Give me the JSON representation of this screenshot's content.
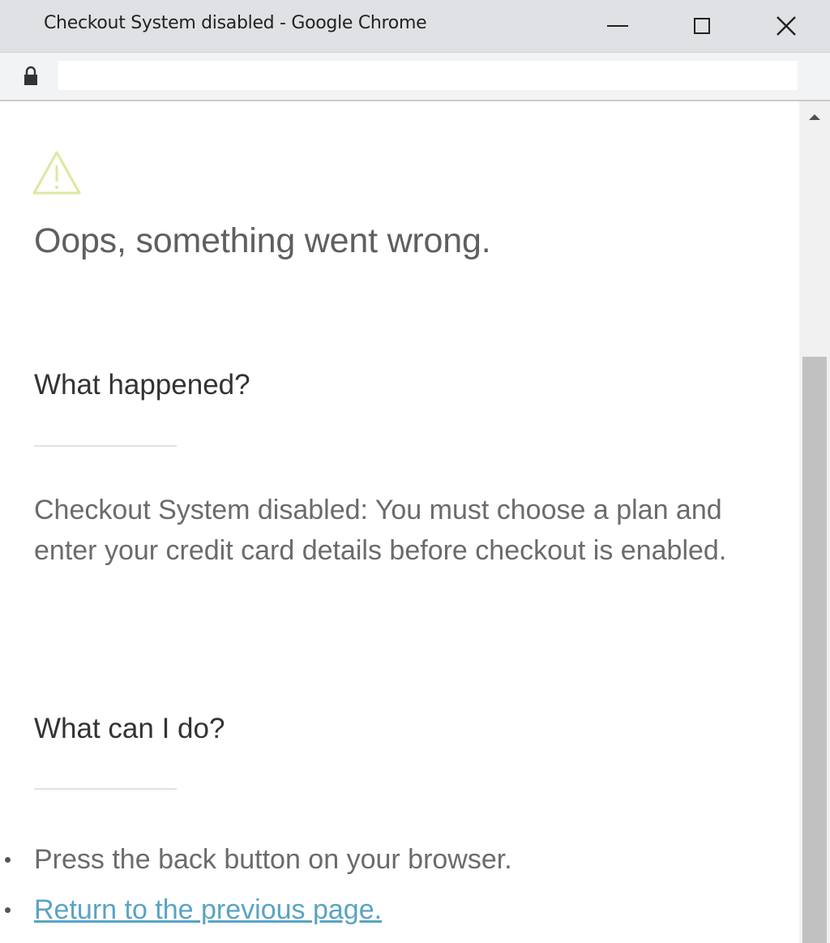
{
  "window": {
    "title": "Checkout System disabled - Google Chrome",
    "controls": {
      "minimize": "minimize",
      "maximize": "maximize",
      "close": "close"
    }
  },
  "address_bar": {
    "url": "",
    "security_icon": "lock-icon"
  },
  "page": {
    "icon": "warning-icon",
    "icon_color": "#d8e28a",
    "heading": "Oops, something went wrong.",
    "what_happened": {
      "title": "What happened?",
      "message": "Checkout System disabled: You must choose a plan and enter your credit card details before checkout is enabled."
    },
    "what_can_i_do": {
      "title": "What can I do?",
      "items": [
        {
          "text": "Press the back button on your browser."
        },
        {
          "text": "Return to the previous page.",
          "link": true
        }
      ]
    },
    "link_color": "#5aa3c4"
  }
}
